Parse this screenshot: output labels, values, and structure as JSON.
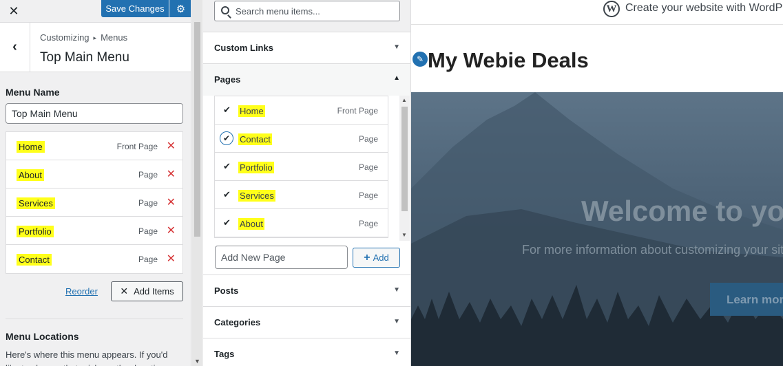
{
  "topbar": {
    "close_icon": "close-icon",
    "save_label": "Save Changes",
    "settings_icon": "gear-icon"
  },
  "section": {
    "breadcrumb_root": "Customizing",
    "breadcrumb_sep": "▸",
    "breadcrumb_parent": "Menus",
    "title": "Top Main Menu"
  },
  "menu": {
    "name_label": "Menu Name",
    "name_value": "Top Main Menu",
    "items": [
      {
        "label": "Home",
        "type": "Front Page"
      },
      {
        "label": "About",
        "type": "Page"
      },
      {
        "label": "Services",
        "type": "Page"
      },
      {
        "label": "Portfolio",
        "type": "Page"
      },
      {
        "label": "Contact",
        "type": "Page"
      }
    ],
    "reorder_label": "Reorder",
    "add_items_label": "Add Items",
    "locations_title": "Menu Locations",
    "locations_desc": "Here's where this menu appears. If you'd like to change that, pick another location."
  },
  "available": {
    "search_placeholder": "Search menu items...",
    "custom_links": "Custom Links",
    "pages_label": "Pages",
    "pages": [
      {
        "label": "Home",
        "type": "Front Page"
      },
      {
        "label": "Contact",
        "type": "Page"
      },
      {
        "label": "Portfolio",
        "type": "Page"
      },
      {
        "label": "Services",
        "type": "Page"
      },
      {
        "label": "About",
        "type": "Page"
      }
    ],
    "add_page_placeholder": "Add New Page",
    "add_button": "Add",
    "posts": "Posts",
    "categories": "Categories",
    "tags": "Tags"
  },
  "preview": {
    "wp_cta": "Create your website with WordPress.com",
    "site_title": "My Webie Deals",
    "hero_title": "Welcome to your site",
    "hero_sub": "For more information about customizing your site",
    "hero_button": "Learn more"
  },
  "colors": {
    "accent": "#2271b1",
    "highlight": "#ffff1a",
    "danger": "#d63638"
  }
}
